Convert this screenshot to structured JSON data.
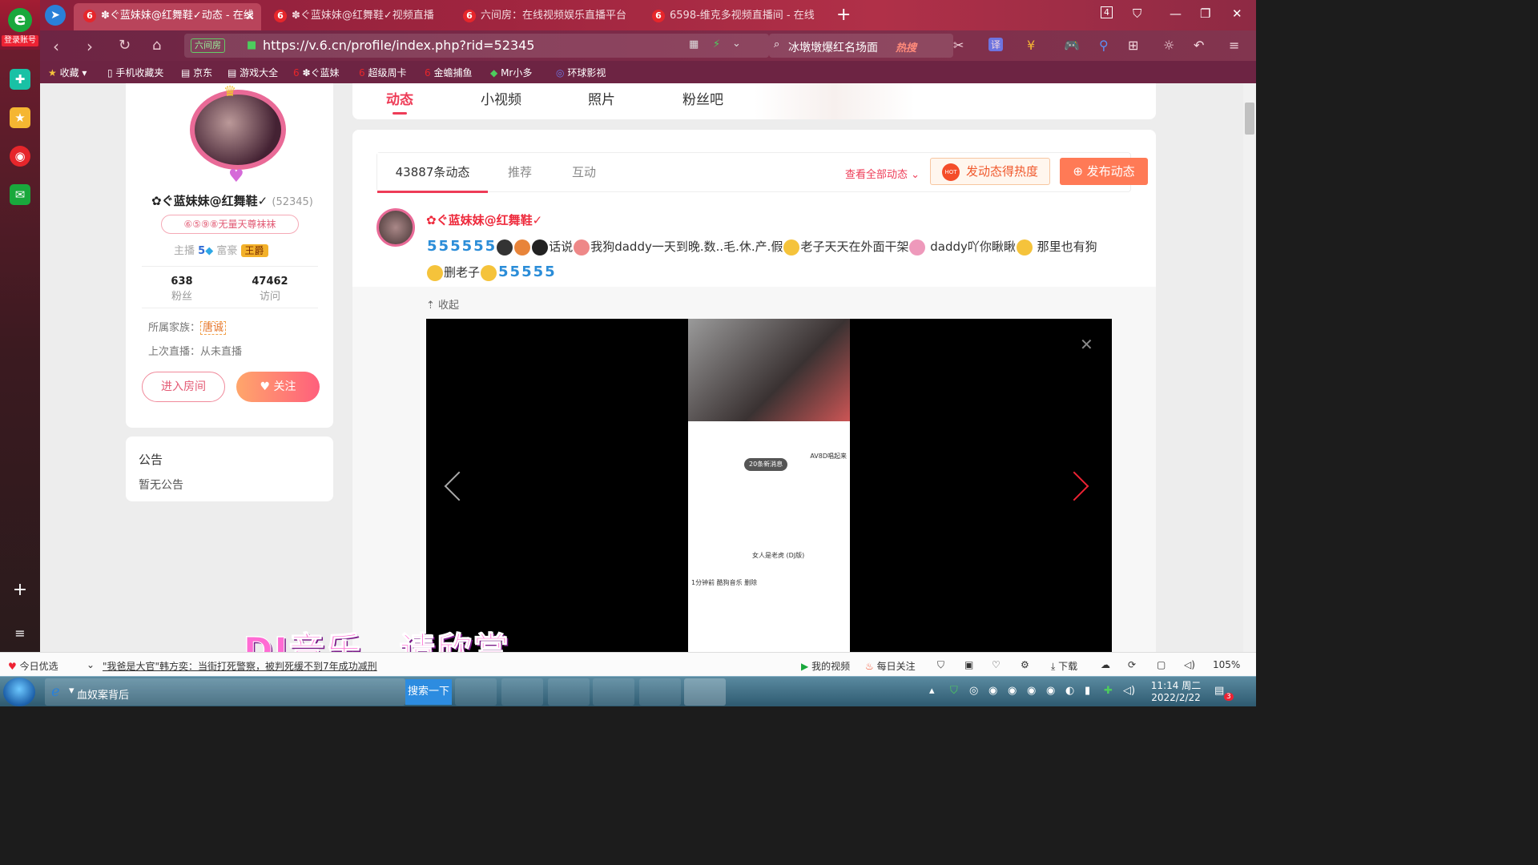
{
  "browser": {
    "login_label": "登录账号",
    "tabs": [
      {
        "title": "✽ぐ蓝妹妹@红舞鞋✓动态 - 在线",
        "active": true
      },
      {
        "title": "✽ぐ蓝妹妹@红舞鞋✓视频直播",
        "active": false
      },
      {
        "title": "六间房：在线视频娱乐直播平台",
        "active": false
      },
      {
        "title": "6598-维克多视频直播间 - 在线",
        "active": false
      }
    ],
    "tab_count": "4",
    "url_badge": "六间房",
    "url": "https://v.6.cn/profile/index.php?rid=52345",
    "search_query": "冰墩墩爆红名场面",
    "search_hot": "热搜",
    "bookmarks": [
      "收藏",
      "手机收藏夹",
      "京东",
      "游戏大全",
      "✽ぐ蓝妹",
      "超级周卡",
      "金蟾捕鱼",
      "Mr小多",
      "环球影视"
    ]
  },
  "profile": {
    "name": "✿ぐ蓝妹妹@红舞鞋✓",
    "rid": "(52345)",
    "pill": "⑥⑤⑨⑧无量天尊袜袜",
    "anchor_label": "主播",
    "anchor_level": "5",
    "rich_label": "富豪",
    "rich_badge": "王爵",
    "fans_count": "638",
    "fans_label": "粉丝",
    "visits_count": "47462",
    "visits_label": "访问",
    "family_label": "所属家族：",
    "family_value": "唐诚",
    "last_live": "上次直播：从未直播",
    "enter_room": "进入房间",
    "follow": "关注"
  },
  "announcement": {
    "title": "公告",
    "body": "暂无公告"
  },
  "page_tabs": [
    "动态",
    "小视频",
    "照片",
    "粉丝吧"
  ],
  "feed": {
    "tabs": [
      "43887条动态",
      "推荐",
      "互动"
    ],
    "view_all": "查看全部动态",
    "hot_button": "发动态得热度",
    "hot_tag": "HOT",
    "post_button": "发布动态",
    "post_author": "✿ぐ蓝妹妹@红舞鞋✓",
    "post_text_1": "话说",
    "post_text_2": "我狗daddy一天到晚.数..毛.休.产.假",
    "post_text_3": "老子天天在外面干架",
    "post_text_4": " daddy吖你瞅瞅",
    "post_text_5": " 那里也有狗",
    "post_text_6": "删老子",
    "collapse": "收起",
    "inner_messages": "20条新消息",
    "inner_line1": "AV8D唱起来",
    "inner_line2": "女人是老虎 (DJ版)",
    "inner_line3": "1分钟前  酷狗音乐  删除"
  },
  "caption": "DJ音乐，请欣赏",
  "status": {
    "today": "今日优选",
    "news": "\"我爸是大官\"韩方奕：当街打死警察，被判死缓不到7年成功减刑",
    "my_video": "我的视频",
    "daily": "每日关注",
    "download": "下载",
    "zoom": "105%"
  },
  "taskbar": {
    "window_title": "血奴案背后",
    "search_btn": "搜索一下",
    "time": "11:14 周二",
    "date": "2022/2/22",
    "notif": "3"
  },
  "colors": {
    "accent": "#ee3c57",
    "follow_gradient_start": "#ffa66b",
    "follow_gradient_end": "#ff5f7c"
  }
}
